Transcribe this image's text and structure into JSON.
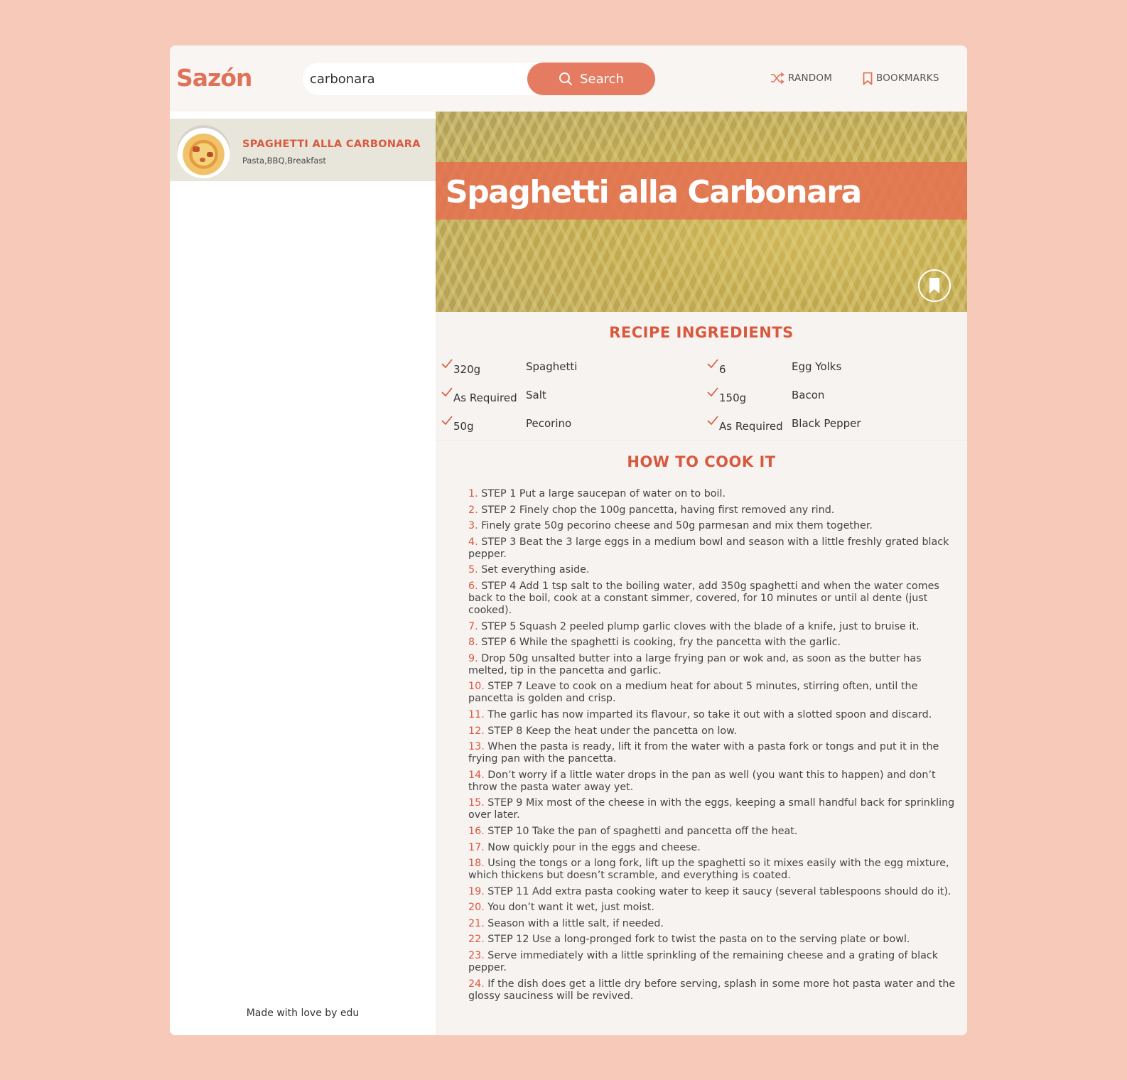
{
  "app": {
    "logo": "Sazón"
  },
  "search": {
    "value": "carbonara",
    "button_label": "Search"
  },
  "nav": {
    "random_label": "RANDOM",
    "bookmarks_label": "BOOKMARKS"
  },
  "sidebar": {
    "results": [
      {
        "title": "SPAGHETTI ALLA CARBONARA",
        "tags": "Pasta,BBQ,Breakfast"
      }
    ],
    "footer": "Made with love by edu"
  },
  "recipe": {
    "title": "Spaghetti alla Carbonara",
    "ingredients_heading": "RECIPE INGREDIENTS",
    "ingredients": [
      {
        "qty": "320g",
        "name": "Spaghetti"
      },
      {
        "qty": "6",
        "name": "Egg Yolks"
      },
      {
        "qty": "As Required",
        "name": "Salt"
      },
      {
        "qty": "150g",
        "name": "Bacon"
      },
      {
        "qty": "50g",
        "name": "Pecorino"
      },
      {
        "qty": "As Required",
        "name": "Black Pepper"
      }
    ],
    "method_heading": "HOW TO COOK IT",
    "steps": [
      "STEP 1 Put a large saucepan of water on to boil.",
      "STEP 2 Finely chop the 100g pancetta, having first removed any rind.",
      "Finely grate 50g pecorino cheese and 50g parmesan and mix them together.",
      "STEP 3 Beat the 3 large eggs in a medium bowl and season with a little freshly grated black pepper.",
      "Set everything aside.",
      "STEP 4 Add 1 tsp salt to the boiling water, add 350g spaghetti and when the water comes back to the boil, cook at a constant simmer, covered, for 10 minutes or until al dente (just cooked).",
      "STEP 5 Squash 2 peeled plump garlic cloves with the blade of a knife, just to bruise it.",
      "STEP 6 While the spaghetti is cooking, fry the pancetta with the garlic.",
      "Drop 50g unsalted butter into a large frying pan or wok and, as soon as the butter has melted, tip in the pancetta and garlic.",
      "STEP 7 Leave to cook on a medium heat for about 5 minutes, stirring often, until the pancetta is golden and crisp.",
      "The garlic has now imparted its flavour, so take it out with a slotted spoon and discard.",
      "STEP 8 Keep the heat under the pancetta on low.",
      "When the pasta is ready, lift it from the water with a pasta fork or tongs and put it in the frying pan with the pancetta.",
      "Don’t worry if a little water drops in the pan as well (you want this to happen) and don’t throw the pasta water away yet.",
      "STEP 9 Mix most of the cheese in with the eggs, keeping a small handful back for sprinkling over later.",
      "STEP 10 Take the pan of spaghetti and pancetta off the heat.",
      "Now quickly pour in the eggs and cheese.",
      "Using the tongs or a long fork, lift up the spaghetti so it mixes easily with the egg mixture, which thickens but doesn’t scramble, and everything is coated.",
      "STEP 11 Add extra pasta cooking water to keep it saucy (several tablespoons should do it).",
      "You don’t want it wet, just moist.",
      "Season with a little salt, if needed.",
      "STEP 12 Use a long-pronged fork to twist the pasta on to the serving plate or bowl.",
      "Serve immediately with a little sprinkling of the remaining cheese and a grating of black pepper.",
      "If the dish does get a little dry before serving, splash in some more hot pasta water and the glossy sauciness will be revived."
    ]
  },
  "colors": {
    "background": "#f7c9b9",
    "accent": "#e57c62",
    "heading": "#d9593f"
  }
}
